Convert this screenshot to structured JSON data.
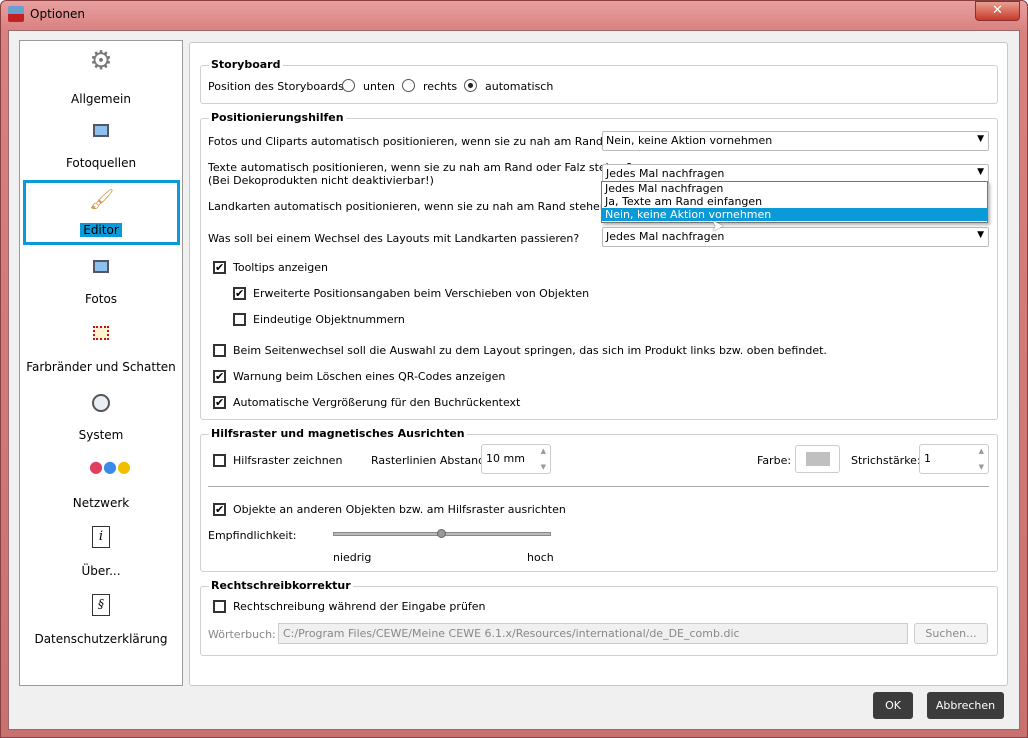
{
  "window": {
    "title": "Optionen",
    "close": "✕"
  },
  "sidebar": {
    "items": [
      {
        "label": "Allgemein",
        "icon": "gear-icon"
      },
      {
        "label": "Fotoquellen",
        "icon": "photo-icon"
      },
      {
        "label": "Editor",
        "icon": "brush-icon"
      },
      {
        "label": "Fotos",
        "icon": "photo-icon"
      },
      {
        "label": "Farbränder und Schatten",
        "icon": "frame-icon"
      },
      {
        "label": "System",
        "icon": "system-icon"
      },
      {
        "label": "Netzwerk",
        "icon": "network-icon"
      },
      {
        "label": "Über...",
        "icon": "info-icon"
      },
      {
        "label": "Datenschutzerklärung",
        "icon": "paragraph-icon"
      }
    ],
    "selected": "Editor"
  },
  "storyboard": {
    "title": "Storyboard",
    "label": "Position des Storyboards:",
    "options": [
      "unten",
      "rechts",
      "automatisch"
    ],
    "selected": "automatisch"
  },
  "positioning": {
    "title": "Positionierungshilfen",
    "q1": "Fotos und Cliparts automatisch positionieren, wenn sie zu nah am Rand stehen?",
    "v1": "Nein, keine Aktion vornehmen",
    "q2": "Texte automatisch positionieren, wenn sie zu nah am Rand oder Falz stehen?",
    "q2b": "(Bei Dekoprodukten nicht deaktivierbar!)",
    "v2": "Jedes Mal nachfragen",
    "q3": "Landkarten automatisch positionieren, wenn sie zu nah am Rand stehen?",
    "q4": "Was soll bei einem Wechsel des Layouts mit Landkarten passieren?",
    "v4": "Jedes Mal nachfragen",
    "dropdown_options": [
      "Jedes Mal nachfragen",
      "Ja, Texte am Rand einfangen",
      "Nein, keine Aktion vornehmen"
    ],
    "checks": [
      {
        "label": "Tooltips anzeigen",
        "checked": true
      },
      {
        "label": "Erweiterte Positionsangaben beim Verschieben von Objekten",
        "checked": true
      },
      {
        "label": "Eindeutige Objektnummern",
        "checked": false
      },
      {
        "label": "Beim Seitenwechsel soll die Auswahl zu dem Layout springen, das sich im Produkt links bzw. oben befindet.",
        "checked": false
      },
      {
        "label": "Warnung beim Löschen eines QR-Codes anzeigen",
        "checked": true
      },
      {
        "label": "Automatische Vergrößerung für den Buchrückentext",
        "checked": true
      }
    ]
  },
  "grid": {
    "title": "Hilfsraster und magnetisches Ausrichten",
    "draw_label": "Hilfsraster zeichnen",
    "draw_checked": false,
    "spacing_label": "Rasterlinien Abstand:",
    "spacing": "10 mm",
    "color_label": "Farbe:",
    "color": "#c0c0c0",
    "stroke_label": "Strichstärke:",
    "stroke": "1",
    "align_label": "Objekte an anderen Objekten bzw. am Hilfsraster ausrichten",
    "align_checked": true,
    "sens_label": "Empfindlichkeit:",
    "sens_value": 0.5,
    "low": "niedrig",
    "high": "hoch"
  },
  "spell": {
    "title": "Rechtschreibkorrektur",
    "check_label": "Rechtschreibung während der Eingabe prüfen",
    "checked": false,
    "dict_label": "Wörterbuch:",
    "dict_path": "C:/Program Files/CEWE/Meine CEWE 6.1.x/Resources/international/de_DE_comb.dic",
    "browse": "Suchen..."
  },
  "buttons": {
    "ok": "OK",
    "cancel": "Abbrechen"
  },
  "check_mark": "✔"
}
